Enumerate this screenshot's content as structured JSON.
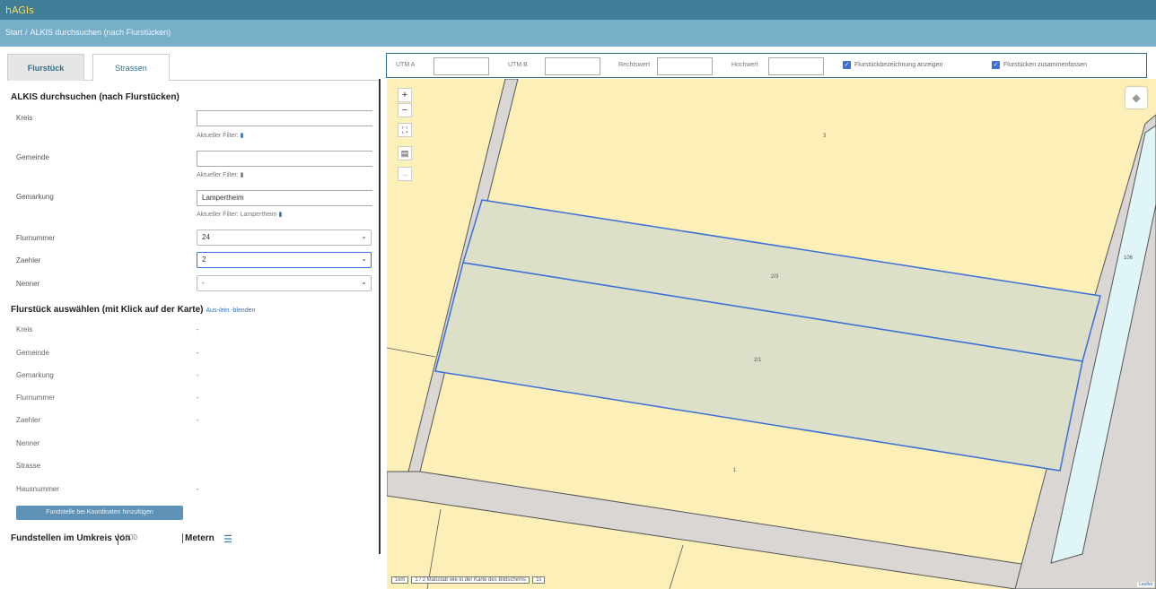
{
  "app": {
    "title": "hAGIs"
  },
  "breadcrumb": {
    "home": "Start",
    "separator": "/",
    "current": "ALKIS durchsuchen (nach Flurstücken)"
  },
  "tabs": [
    {
      "label": "Flurstück"
    },
    {
      "label": "Strassen"
    }
  ],
  "search": {
    "title": "ALKIS durchsuchen (nach Flurstücken)",
    "kreis": {
      "label": "Kreis",
      "value": "",
      "hint": "Aktueller Filter:",
      "hint_value": ""
    },
    "gemeinde": {
      "label": "Gemeinde",
      "value": "",
      "hint": "Aktueller Filter:",
      "hint_value": ""
    },
    "gemarkung": {
      "label": "Gemarkung",
      "value": "Lampertheim",
      "hint": "Aktueller Filter:",
      "hint_value": "Lampertheim"
    },
    "flurnummer": {
      "label": "Flurnummer",
      "value": "24"
    },
    "zaehler": {
      "label": "Zaehler",
      "value": "2"
    },
    "nenner": {
      "label": "Nenner",
      "value": "-"
    }
  },
  "selection": {
    "title": "Flurstück auswählen (mit Klick auf der Karte)",
    "toggle_link": "Aus-/ein -blenden",
    "rows": [
      {
        "label": "Kreis",
        "value": "-"
      },
      {
        "label": "Gemeinde",
        "value": "-"
      },
      {
        "label": "Gemarkung",
        "value": "-"
      },
      {
        "label": "Flurnummer",
        "value": "-"
      },
      {
        "label": "Zaehler",
        "value": "-"
      },
      {
        "label": "Nenner",
        "value": ""
      },
      {
        "label": "Strasse",
        "value": ""
      },
      {
        "label": "Hausnummer",
        "value": "-"
      }
    ],
    "add_button": "Fundstelle bei Koordinaten hinzufügen"
  },
  "radius": {
    "label": "Fundstellen im Umkreis von",
    "value": "1000",
    "unit": "Metern"
  },
  "coordbar": {
    "utm_a_label": "UTM A",
    "utm_b_label": "UTM B",
    "rechtswert_label": "Rechtswert",
    "hochwert_label": "Hochwert",
    "check1_label": "Flurstückbezeichnung anzeigen",
    "check2_label": "Flurstücken zusammenfassen"
  },
  "map": {
    "scale_box": "1km",
    "scale_text": "1 / 2 Maßstab wie in der Karte des Bildschirms",
    "scale_extra": "1s",
    "attribution": "Leaflet",
    "parcel_labels": {
      "upper": "2/3",
      "lower": "2/1",
      "top": "3",
      "bottom": "1",
      "right": "106"
    }
  },
  "colors": {
    "topbar": "#3f7e96",
    "crumbbar": "#78afc8",
    "map_bg": "#fcf0b8",
    "parcel_fill": "#dde0c8",
    "parcel_border": "#3a6fd8"
  },
  "icons": [
    "zoom-in-icon",
    "zoom-out-icon",
    "fullscreen-icon",
    "print-icon",
    "layers-icon",
    "list-icon"
  ]
}
